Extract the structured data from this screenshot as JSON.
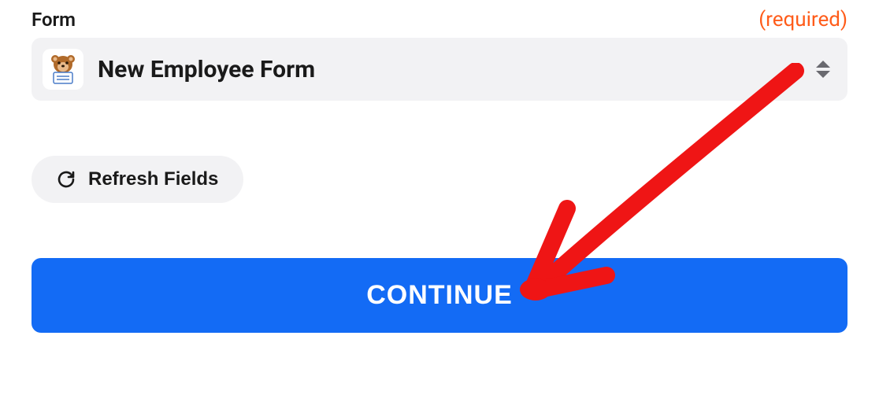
{
  "form_field": {
    "label": "Form",
    "required_tag": "(required)",
    "selected_value": "New Employee Form",
    "app_icon": "wpforms-bear-icon"
  },
  "refresh_button": {
    "label": "Refresh Fields"
  },
  "continue_button": {
    "label": "CONTINUE"
  },
  "annotation": {
    "name": "red-arrow-annotation",
    "color": "#ef1515"
  },
  "colors": {
    "accent": "#136bf5",
    "required": "#ff5c1a",
    "panel": "#f2f2f4"
  }
}
